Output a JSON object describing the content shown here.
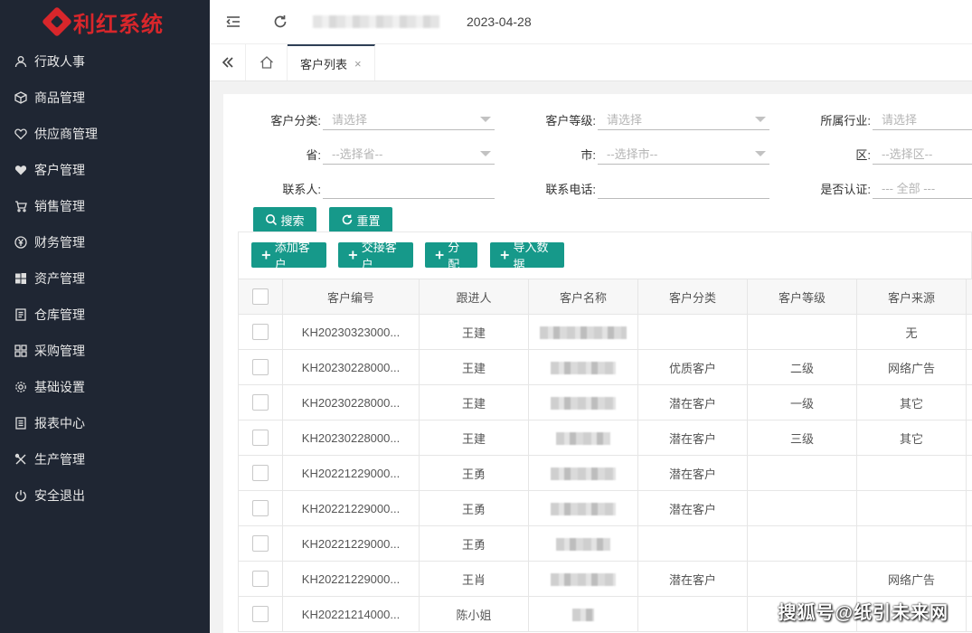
{
  "app": {
    "logo_text": "利红系统",
    "brand_color": "#d8262b",
    "accent_color": "#16998a"
  },
  "header": {
    "date": "2023-04-28"
  },
  "sidebar": {
    "items": [
      {
        "label": "行政人事",
        "icon": "user-icon"
      },
      {
        "label": "商品管理",
        "icon": "cube-icon"
      },
      {
        "label": "供应商管理",
        "icon": "heart-outline-icon"
      },
      {
        "label": "客户管理",
        "icon": "heart-icon"
      },
      {
        "label": "销售管理",
        "icon": "cart-icon"
      },
      {
        "label": "财务管理",
        "icon": "yen-icon"
      },
      {
        "label": "资产管理",
        "icon": "windows-icon"
      },
      {
        "label": "仓库管理",
        "icon": "document-icon"
      },
      {
        "label": "采购管理",
        "icon": "grid-icon"
      },
      {
        "label": "基础设置",
        "icon": "gear-icon"
      },
      {
        "label": "报表中心",
        "icon": "report-icon"
      },
      {
        "label": "生产管理",
        "icon": "tools-icon"
      },
      {
        "label": "安全退出",
        "icon": "power-icon"
      }
    ]
  },
  "tabs": {
    "active_label": "客户列表",
    "close_glyph": "×"
  },
  "filters": {
    "category_label": "客户分类:",
    "category_placeholder": "请选择",
    "level_label": "客户等级:",
    "level_placeholder": "请选择",
    "industry_label": "所属行业:",
    "industry_placeholder": "请选择",
    "province_label": "省:",
    "province_placeholder": "--选择省--",
    "city_label": "市:",
    "city_placeholder": "--选择市--",
    "district_label": "区:",
    "district_placeholder": "--选择区--",
    "contact_label": "联系人:",
    "phone_label": "联系电话:",
    "verified_label": "是否认证:",
    "verified_placeholder": "--- 全部 ---",
    "search_label": "搜索",
    "reset_label": "重置"
  },
  "toolbar": {
    "add_label": "添加客户",
    "handover_label": "交接客户",
    "assign_label": "分配",
    "import_label": "导入数据"
  },
  "table": {
    "headers": [
      "客户编号",
      "跟进人",
      "客户名称",
      "客户分类",
      "客户等级",
      "客户来源"
    ],
    "rows": [
      {
        "code": "KH20230323000...",
        "owner": "王建",
        "category": "",
        "level": "",
        "source": "无"
      },
      {
        "code": "KH20230228000...",
        "owner": "王建",
        "category": "优质客户",
        "level": "二级",
        "source": "网络广告"
      },
      {
        "code": "KH20230228000...",
        "owner": "王建",
        "category": "潜在客户",
        "level": "一级",
        "source": "其它"
      },
      {
        "code": "KH20230228000...",
        "owner": "王建",
        "category": "潜在客户",
        "level": "三级",
        "source": "其它"
      },
      {
        "code": "KH20221229000...",
        "owner": "王勇",
        "category": "潜在客户",
        "level": "",
        "source": ""
      },
      {
        "code": "KH20221229000...",
        "owner": "王勇",
        "category": "潜在客户",
        "level": "",
        "source": ""
      },
      {
        "code": "KH20221229000...",
        "owner": "王勇",
        "category": "",
        "level": "",
        "source": ""
      },
      {
        "code": "KH20221229000...",
        "owner": "王肖",
        "category": "潜在客户",
        "level": "",
        "source": "网络广告"
      },
      {
        "code": "KH20221214000...",
        "owner": "陈小姐",
        "category": "",
        "level": "",
        "source": ""
      }
    ]
  },
  "watermark": "搜狐号@纸引未来网"
}
